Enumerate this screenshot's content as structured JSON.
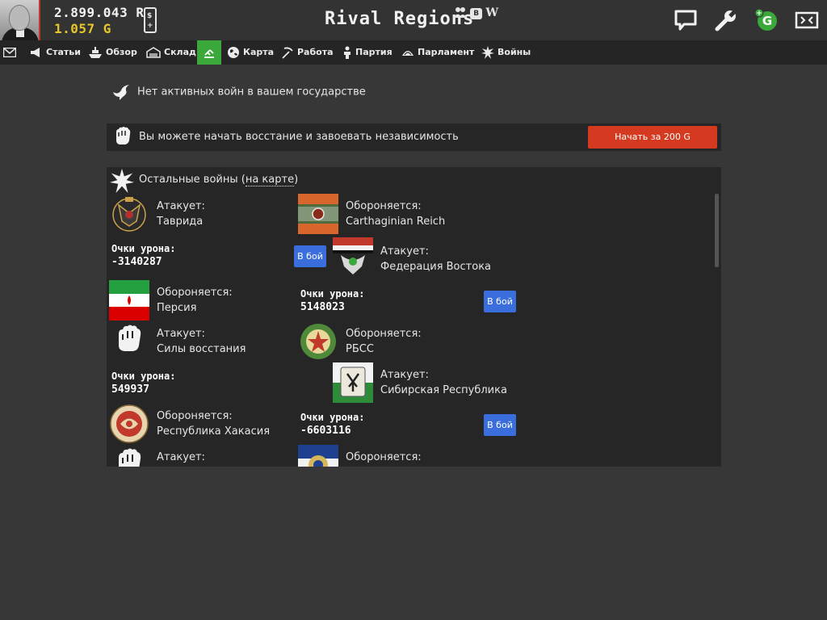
{
  "header": {
    "money_r": "2.899.043 R",
    "money_g": "1.057 G",
    "logo": "Rival Regions",
    "social_vk": "В",
    "social_wiki": "W",
    "phone_glyph_top": "$",
    "phone_glyph_bottom": "+",
    "gold_badge": "G"
  },
  "menu": {
    "items": [
      {
        "label": "",
        "icon": "envelope-icon"
      },
      {
        "label": "Статьи",
        "icon": "megaphone-icon"
      },
      {
        "label": "Обзор",
        "icon": "ship-icon"
      },
      {
        "label": "Склад",
        "icon": "warehouse-icon"
      },
      {
        "label": "",
        "icon": "factory-icon",
        "active": true
      },
      {
        "label": "Карта",
        "icon": "globe-icon"
      },
      {
        "label": "Работа",
        "icon": "pickaxe-icon"
      },
      {
        "label": "Партия",
        "icon": "person-icon"
      },
      {
        "label": "Парламент",
        "icon": "parliament-icon"
      },
      {
        "label": "Войны",
        "icon": "explosion-icon"
      }
    ]
  },
  "no_war_text": "Нет активных войн в вашем государстве",
  "uprising": {
    "text": "Вы можете начать восстание и завоевать независимость",
    "button": "Начать за 200 G"
  },
  "other_wars": {
    "title_prefix": "Остальные войны (",
    "title_link": "на карте",
    "title_suffix": ")",
    "damage_label": "Очки урона:",
    "fight_label": "В бой",
    "attack_label": "Атакует:",
    "defend_label": "Обороняется:",
    "wars": [
      {
        "attacker": "Таврида",
        "defender": "Carthaginian Reich",
        "damage": "-3140287"
      },
      {
        "attacker": "Федерация Востока",
        "defender": "Персия",
        "damage": "5148023"
      },
      {
        "attacker": "Силы восстания",
        "defender": "РБСС",
        "damage": "549937"
      },
      {
        "attacker": "Сибирская Республика",
        "defender": "Республика Хакасия",
        "damage": "-6603116"
      },
      {
        "attacker": "",
        "defender": ""
      }
    ]
  },
  "colors": {
    "accent_green": "#3aa83a",
    "start_button": "#d53a20",
    "fight_button": "#3a6edc",
    "gold": "#e6c628"
  }
}
